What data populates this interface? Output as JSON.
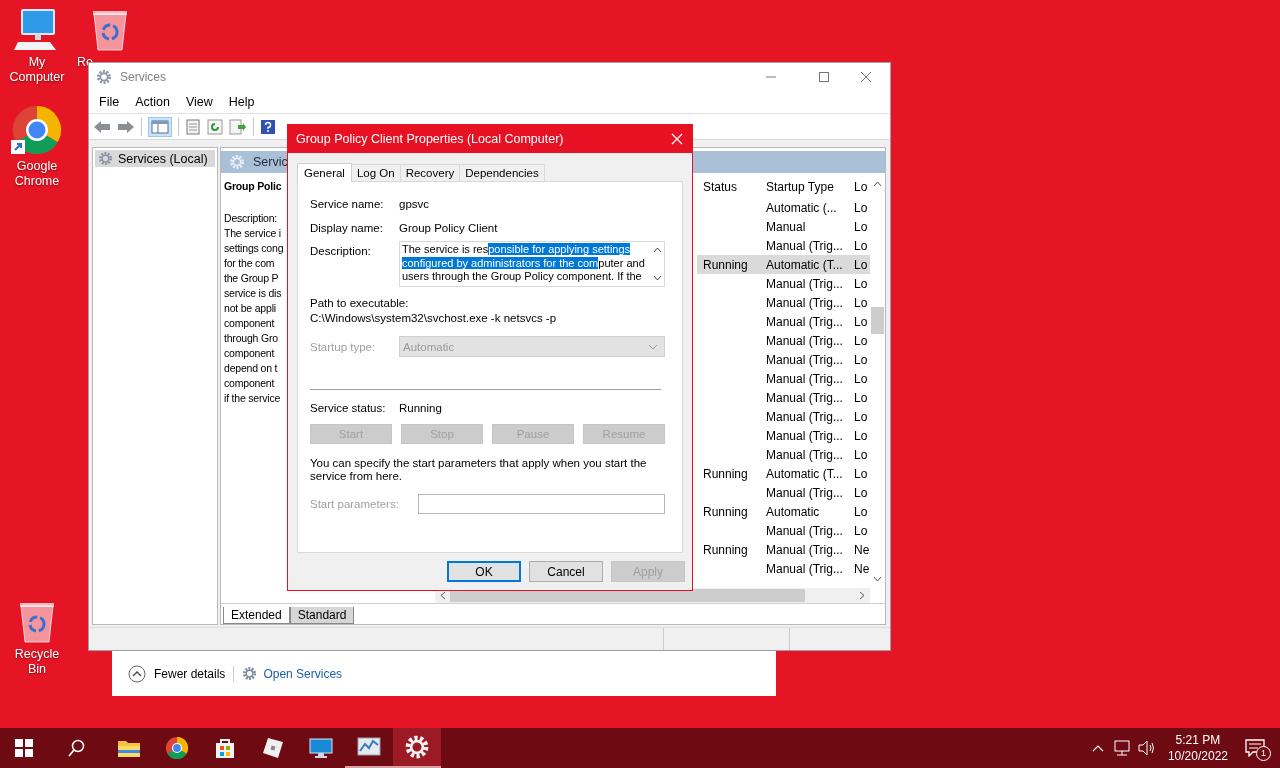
{
  "desktop_icons": [
    {
      "label": "My Computer",
      "kind": "computer"
    },
    {
      "label": "Re",
      "kind": "bin"
    },
    {
      "label": "Google Chrome",
      "kind": "chrome"
    },
    {
      "label": "Recycle Bin",
      "kind": "bin"
    }
  ],
  "task_manager": {
    "fewer_details": "Fewer details",
    "open_services": "Open Services"
  },
  "services": {
    "title": "Services",
    "menu": [
      "File",
      "Action",
      "View",
      "Help"
    ],
    "tree": [
      {
        "label": "Services (Local)",
        "selected": true
      }
    ],
    "pane_header": "Servic",
    "detail_title": "Group Polic",
    "detail_lines": [
      "Description:",
      "The service i",
      "settings cong",
      "for the com",
      "the Group P",
      "service is dis",
      "not be appli",
      "component",
      "through Gro",
      "component",
      "depend on t",
      "component",
      "if the service"
    ],
    "columns": [
      "Status",
      "Startup Type",
      "Lo"
    ],
    "rows": [
      {
        "startup": "Automatic (...",
        "log": "Lo",
        "selected": false
      },
      {
        "startup": "Manual",
        "log": "Lo",
        "selected": false
      },
      {
        "startup": "Manual (Trig...",
        "log": "Lo",
        "selected": false
      },
      {
        "status": "Running",
        "startup": "Automatic (T...",
        "log": "Lo",
        "selected": true
      },
      {
        "startup": "Manual (Trig...",
        "log": "Lo",
        "selected": false
      },
      {
        "startup": "Manual (Trig...",
        "log": "Lo",
        "selected": false
      },
      {
        "startup": "Manual (Trig...",
        "log": "Lo",
        "selected": false
      },
      {
        "startup": "Manual (Trig...",
        "log": "Lo",
        "selected": false
      },
      {
        "startup": "Manual (Trig...",
        "log": "Lo",
        "selected": false
      },
      {
        "startup": "Manual (Trig...",
        "log": "Lo",
        "selected": false
      },
      {
        "startup": "Manual (Trig...",
        "log": "Lo",
        "selected": false
      },
      {
        "startup": "Manual (Trig...",
        "log": "Lo",
        "selected": false
      },
      {
        "startup": "Manual (Trig...",
        "log": "Lo",
        "selected": false
      },
      {
        "startup": "Manual (Trig...",
        "log": "Lo",
        "selected": false
      },
      {
        "status": "Running",
        "startup": "Automatic (T...",
        "log": "Lo",
        "selected": false
      },
      {
        "startup": "Manual (Trig...",
        "log": "Lo",
        "selected": false
      },
      {
        "status": "Running",
        "startup": "Automatic",
        "log": "Lo",
        "selected": false
      },
      {
        "startup": "Manual (Trig...",
        "log": "Lo",
        "selected": false
      },
      {
        "status": "Running",
        "startup": "Manual (Trig...",
        "log": "Ne",
        "selected": false
      },
      {
        "startup": "Manual (Trig...",
        "log": "Ne",
        "selected": false
      }
    ],
    "view_tabs": [
      {
        "label": "Extended",
        "selected": true
      },
      {
        "label": "Standard",
        "selected": false
      }
    ]
  },
  "dialog": {
    "title": "Group Policy Client Properties (Local Computer)",
    "tabs": [
      {
        "label": "General",
        "selected": true
      },
      {
        "label": "Log On",
        "selected": false
      },
      {
        "label": "Recovery",
        "selected": false
      },
      {
        "label": "Dependencies",
        "selected": false
      }
    ],
    "service_name": {
      "label": "Service name:",
      "value": "gpsvc"
    },
    "display_name": {
      "label": "Display name:",
      "value": "Group Policy Client"
    },
    "description": {
      "label": "Description:",
      "segments": [
        {
          "text": "The service is res",
          "selected": false
        },
        {
          "text": "ponsible for applying settings configured by administrators for the com",
          "selected": true
        },
        {
          "text": "puter and users through the Group Policy component. If the",
          "selected": false
        }
      ]
    },
    "path": {
      "label": "Path to executable:",
      "value": "C:\\Windows\\system32\\svchost.exe -k netsvcs -p"
    },
    "startup_type": {
      "label": "Startup type:",
      "value": "Automatic",
      "disabled": true
    },
    "service_status": {
      "label": "Service status:",
      "value": "Running"
    },
    "control_buttons": [
      {
        "label": "Start",
        "disabled": true
      },
      {
        "label": "Stop",
        "disabled": true
      },
      {
        "label": "Pause",
        "disabled": true
      },
      {
        "label": "Resume",
        "disabled": true
      }
    ],
    "note": "You can specify the start parameters that apply when you start the service from here.",
    "start_parameters": {
      "label": "Start parameters:",
      "disabled": true
    },
    "buttons": [
      {
        "label": "OK",
        "default": true,
        "disabled": false
      },
      {
        "label": "Cancel",
        "default": false,
        "disabled": false
      },
      {
        "label": "Apply",
        "default": false,
        "disabled": true
      }
    ]
  },
  "taskbar": {
    "apps": [
      {
        "kind": "explorer",
        "running": false,
        "active": false
      },
      {
        "kind": "chrome",
        "running": false,
        "active": false
      },
      {
        "kind": "store",
        "running": false,
        "active": false
      },
      {
        "kind": "cube",
        "running": false,
        "active": false
      },
      {
        "kind": "monitor",
        "running": false,
        "active": false
      },
      {
        "kind": "chart",
        "running": true,
        "active": false
      },
      {
        "kind": "gear",
        "running": true,
        "active": true
      }
    ],
    "time": "5:21 PM",
    "date": "10/20/2022",
    "notifications": "1"
  }
}
